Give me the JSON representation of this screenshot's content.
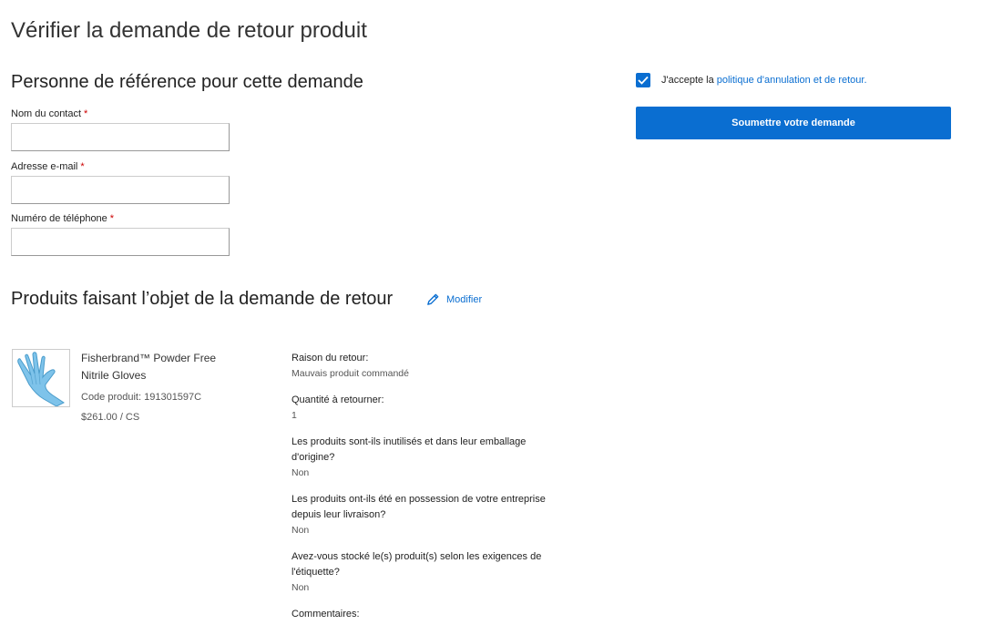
{
  "page_title": "Vérifier la demande de retour produit",
  "contact": {
    "title": "Personne de référence pour cette demande",
    "fields": [
      {
        "label": "Nom du contact",
        "required_mark": "*",
        "value": ""
      },
      {
        "label": "Adresse e-mail",
        "required_mark": "*",
        "value": ""
      },
      {
        "label": "Numéro de téléphone",
        "required_mark": "*",
        "value": ""
      }
    ]
  },
  "accept": {
    "checked": true,
    "text": "J'accepte la",
    "link": "politique d'annulation et de retour."
  },
  "submit_label": "Soumettre votre demande",
  "products": {
    "title": "Produits faisant l’objet de la demande de retour",
    "modify_label": "Modifier",
    "item": {
      "name": "Fisherbrand™ Powder Free Nitrile Gloves",
      "code": "Code produit: 191301597C",
      "price": "$261.00 / CS",
      "details": [
        {
          "q": "Raison du retour:",
          "a": "Mauvais produit commandé"
        },
        {
          "q": "Quantité à retourner:",
          "a": "1"
        },
        {
          "q": "Les produits sont-ils inutilisés et dans leur emballage d'origine?",
          "a": "Non"
        },
        {
          "q": "Les produits ont-ils été en possession de votre entreprise depuis leur livraison?",
          "a": "Non"
        },
        {
          "q": "Avez-vous stocké le(s) produit(s) selon les exigences de l'étiquette?",
          "a": "Non"
        },
        {
          "q": "Commentaires:",
          "a": ""
        }
      ]
    }
  },
  "colors": {
    "accent": "#0a6ed1",
    "required": "#cc0000"
  },
  "icons": {
    "checkbox": "checkmark-icon",
    "modify": "pencil-icon",
    "product": "glove-image"
  }
}
